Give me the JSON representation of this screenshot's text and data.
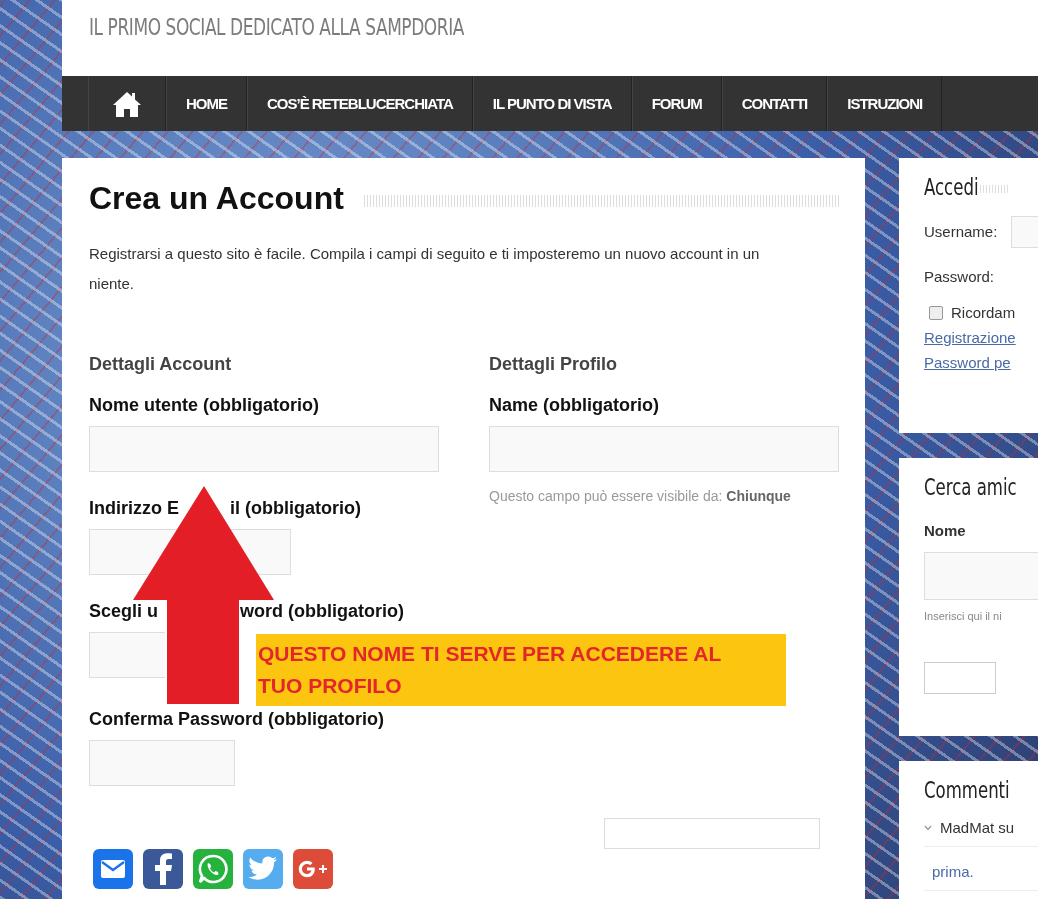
{
  "site": {
    "tagline": "IL PRIMO SOCIAL DEDICATO ALLA SAMPDORIA"
  },
  "nav": {
    "items": [
      {
        "label": "HOME"
      },
      {
        "label": "COS’È RETEBLUCERCHIATA"
      },
      {
        "label": "IL PUNTO DI VISTA"
      },
      {
        "label": "FORUM"
      },
      {
        "label": "CONTATTI"
      },
      {
        "label": "ISTRUZIONI"
      }
    ]
  },
  "main": {
    "title": "Crea un Account",
    "intro": "Registrarsi a questo sito è facile. Compila i campi di seguito e ti imposteremo un nuovo account in un niente.",
    "account": {
      "heading": "Dettagli Account",
      "fields": [
        {
          "label_parts": [
            "Nome utente (obbligatorio)"
          ]
        },
        {
          "label_parts": [
            "Indirizzo E",
            "il (obbligatorio)"
          ]
        },
        {
          "label_parts": [
            "Scegli u",
            "word (obbligatorio)"
          ]
        },
        {
          "label_parts": [
            "Conferma Password (obbligatorio)"
          ]
        }
      ]
    },
    "profile": {
      "heading": "Dettagli Profilo",
      "field_label": "Name (obbligatorio)",
      "hint": "Questo campo può essere visibile da:",
      "hint_value": "Chiunque"
    },
    "share": [
      {
        "kind": "email",
        "color": "#1a73e8"
      },
      {
        "kind": "facebook",
        "color": "#3b5998"
      },
      {
        "kind": "whatsapp",
        "color": "#25b33d"
      },
      {
        "kind": "twitter",
        "color": "#55acee"
      },
      {
        "kind": "google",
        "color": "#dd4b39"
      }
    ],
    "callout": "QUESTO NOME TI SERVE PER ACCEDERE AL TUO PROFILO"
  },
  "sidebar": {
    "login": {
      "title": "Accedi",
      "username_label": "Username:",
      "password_label": "Password:",
      "remember": {
        "label": "Ricordam",
        "checked": false
      },
      "links": [
        "Registrazione",
        "Password pe"
      ]
    },
    "search": {
      "title": "Cerca amic",
      "label": "Nome",
      "hint": "Inserisci qui il ni"
    },
    "comments": {
      "title": "Commenti",
      "items": [
        "MadMat su",
        "prima."
      ]
    }
  }
}
